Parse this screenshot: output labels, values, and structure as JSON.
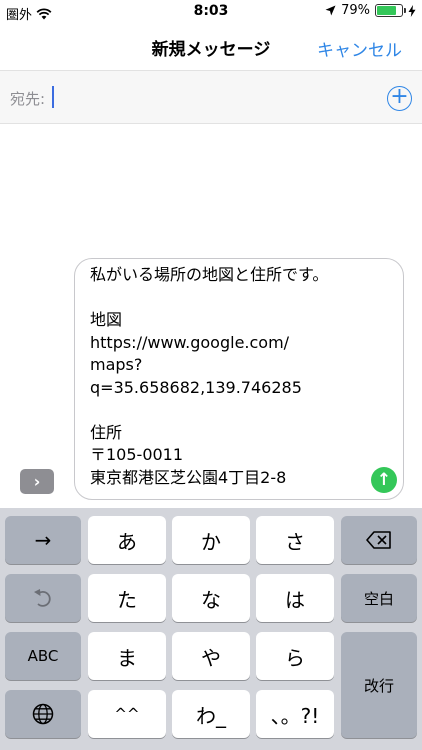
{
  "status_bar": {
    "carrier": "圏外",
    "time": "8:03",
    "battery_percent": "79%",
    "battery_level": 0.79,
    "battery_color": "#34c759"
  },
  "nav": {
    "title": "新規メッセージ",
    "cancel_label": "キャンセル"
  },
  "to_field": {
    "label": "宛先:",
    "add_icon": "plus-circle-icon"
  },
  "message": {
    "text": "私がいる場所の地図と住所です。\n\n地図\nhttps://www.google.com/\nmaps?\nq=35.658682,139.746285\n\n住所\n〒105-0011\n東京都港区芝公園4丁目2-8",
    "send_icon": "arrow-up-icon"
  },
  "expand_icon": "chevron-right-icon",
  "keyboard": {
    "row1": {
      "left": "→",
      "keys": [
        "あ",
        "か",
        "さ"
      ],
      "right_icon": "delete-icon"
    },
    "row2": {
      "left_icon": "undo-icon",
      "keys": [
        "た",
        "な",
        "は"
      ],
      "right": "空白"
    },
    "row3": {
      "left": "ABC",
      "keys": [
        "ま",
        "や",
        "ら"
      ],
      "right": "改行"
    },
    "row4": {
      "left_icon": "globe-icon",
      "keys": [
        "^^",
        "わ_",
        "、。?!"
      ]
    }
  },
  "colors": {
    "accent": "#2f86e6",
    "send": "#34c759"
  }
}
